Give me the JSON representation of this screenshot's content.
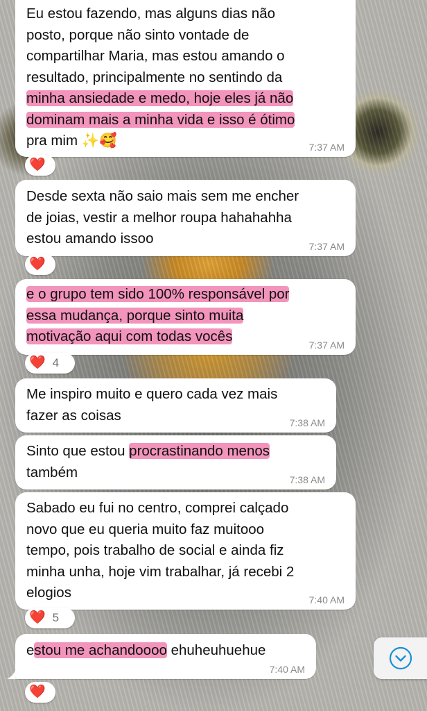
{
  "messages": [
    {
      "lines": [
        [
          "Eu estou fazendo, mas alguns dias não"
        ],
        [
          "posto, porque não sinto vontade de"
        ],
        [
          "compartilhar Maria, mas estou amando o"
        ],
        [
          "resultado, principalmente no sentindo da"
        ],
        [
          "minha ansiedade e medo, hoje eles já não"
        ],
        [
          "dominam mais a minha vida e isso é ótimo"
        ],
        [
          "pra mim ✨🥰"
        ]
      ],
      "time": "7:37 AM",
      "reaction": {
        "emoji": "❤️",
        "count": ""
      }
    },
    {
      "lines": [
        [
          "Desde sexta não saio mais sem me encher"
        ],
        [
          "de joias, vestir a melhor roupa hahahahha"
        ],
        [
          "estou amando issoo"
        ]
      ],
      "time": "7:37 AM",
      "reaction": {
        "emoji": "❤️",
        "count": ""
      }
    },
    {
      "lines": [
        [
          "e o grupo tem sido 100% responsável por"
        ],
        [
          "essa mudança, porque sinto muita"
        ],
        [
          "motivação aqui com todas vocês"
        ]
      ],
      "time": "7:37 AM",
      "reaction": {
        "emoji": "❤️",
        "count": "4"
      }
    },
    {
      "lines": [
        [
          "Me inspiro muito e quero cada vez mais"
        ],
        [
          "fazer as coisas"
        ]
      ],
      "time": "7:38 AM"
    },
    {
      "lines": [
        [
          "Sinto que estou procrastinando menos"
        ],
        [
          "também"
        ]
      ],
      "time": "7:38 AM"
    },
    {
      "lines": [
        [
          "Sabado eu fui no centro, comprei calçado"
        ],
        [
          "novo que eu queria muito faz muitooo"
        ],
        [
          "tempo, pois trabalho de social e ainda fiz"
        ],
        [
          "minha unha, hoje vim trabalhar, já recebi 2"
        ],
        [
          "elogios"
        ]
      ],
      "time": "7:40 AM",
      "reaction": {
        "emoji": "❤️",
        "count": "5"
      }
    },
    {
      "lines": [
        [
          "estou me achandoooo ehuheuhuehue"
        ]
      ],
      "time": "7:40 AM",
      "reaction": {
        "emoji": "❤️",
        "count": ""
      }
    }
  ],
  "scroll_button": {
    "icon": "chevron-down-icon"
  },
  "colors": {
    "highlight": "#ee70a5",
    "heart": "#e0222e",
    "bubble": "#ffffff"
  }
}
